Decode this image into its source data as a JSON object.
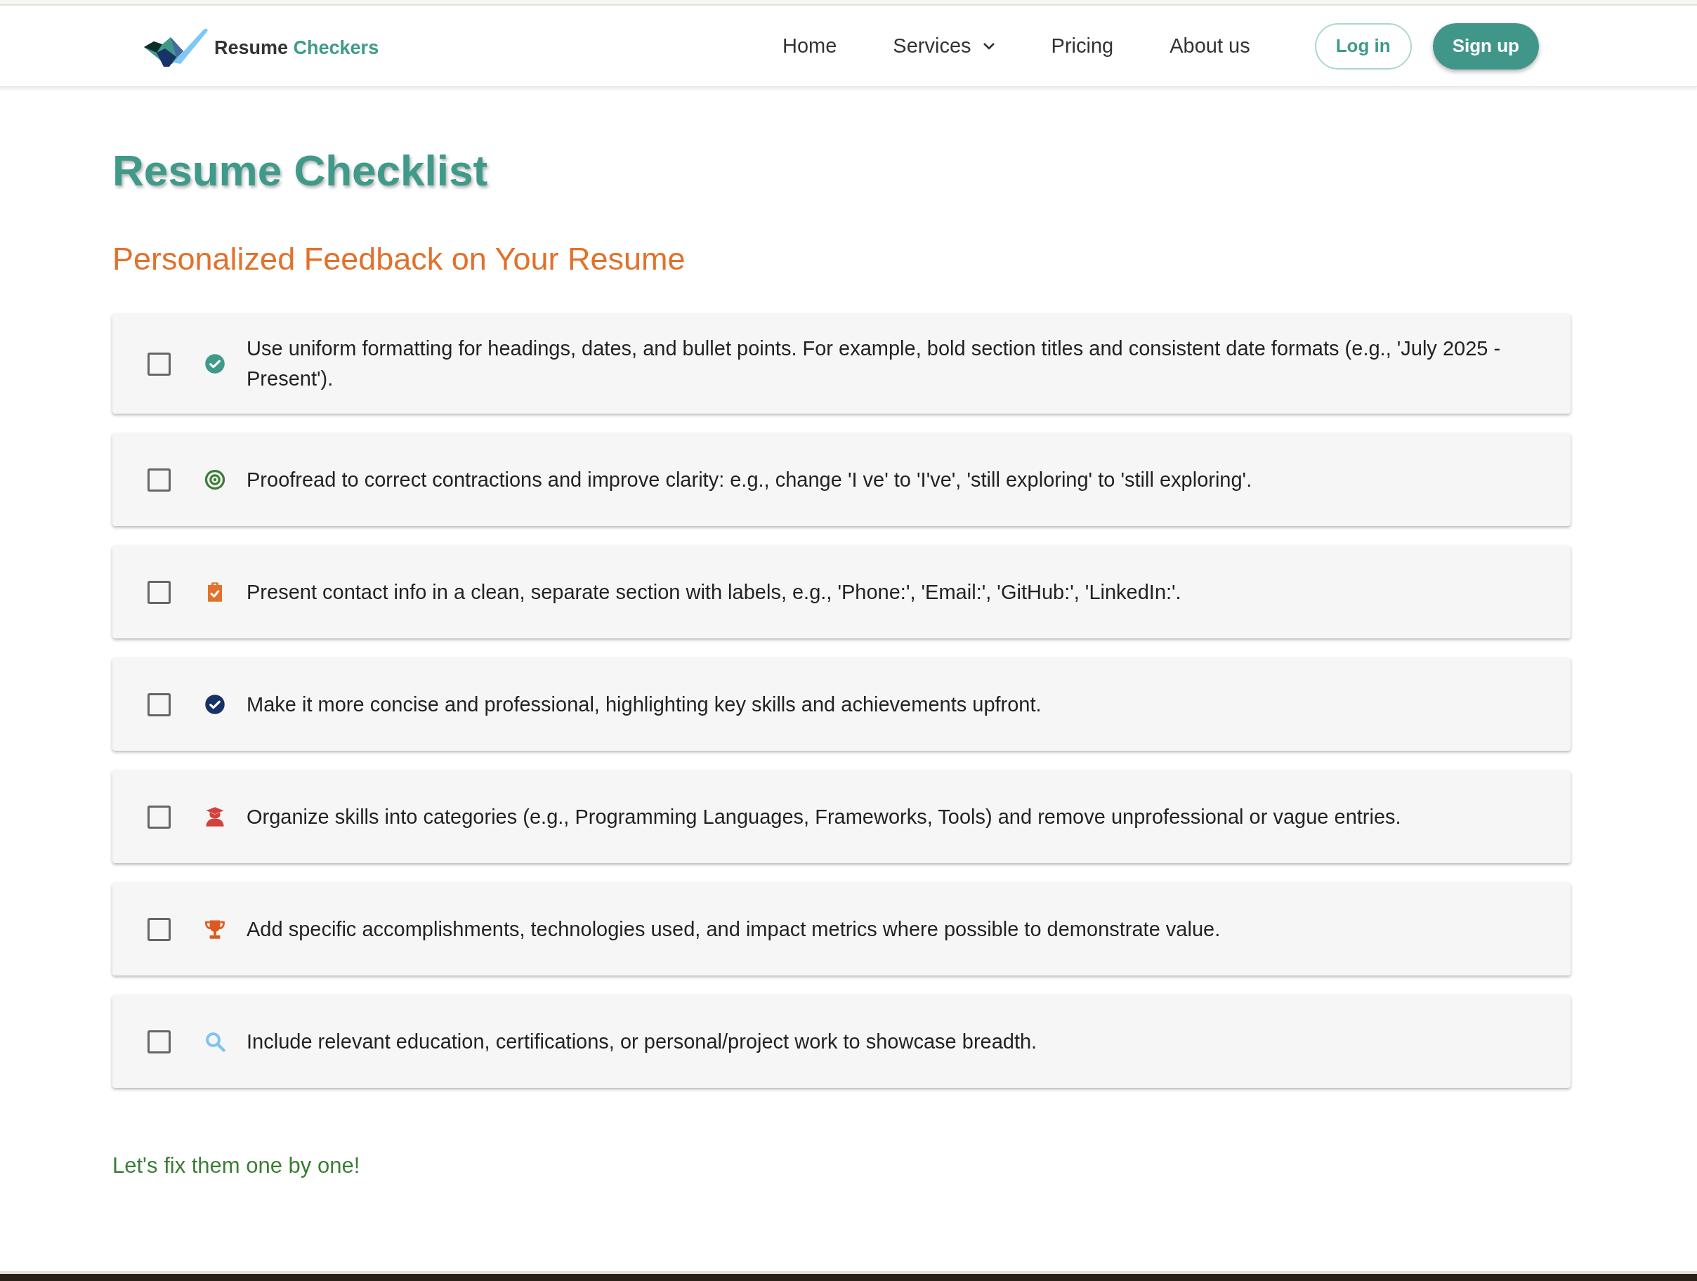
{
  "header": {
    "logo": {
      "word_1": "Resume",
      "word_2": "Checkers"
    },
    "nav": [
      {
        "label": "Home",
        "kind": "link"
      },
      {
        "label": "Services",
        "kind": "dropdown"
      },
      {
        "label": "Pricing",
        "kind": "link"
      },
      {
        "label": "About us",
        "kind": "link"
      }
    ],
    "buttons": [
      {
        "label": "Log in",
        "kind": "outline"
      },
      {
        "label": "Sign up",
        "kind": "filled"
      }
    ]
  },
  "title": "Resume Checklist",
  "subtitle": "Personalized Feedback on Your Resume",
  "items": [
    {
      "checked": false,
      "kind": "check-circle",
      "color": "#3f9a8a",
      "text": "Use uniform formatting for headings, dates, and bullet points. For example, bold section titles and consistent date formats (e.g., 'July 2025 - Present')."
    },
    {
      "checked": false,
      "kind": "target",
      "color": "#3b7d35",
      "text": "Proofread to correct contractions and improve clarity: e.g., change 'I ve' to 'I've', 'still exploring' to 'still exploring'."
    },
    {
      "checked": false,
      "kind": "clipboard",
      "color": "#e2712b",
      "text": "Present contact info in a clean, separate section with labels, e.g., 'Phone:', 'Email:', 'GitHub:', 'LinkedIn:'."
    },
    {
      "checked": false,
      "kind": "check-circle",
      "color": "#173166",
      "text": "Make it more concise and professional, highlighting key skills and achievements upfront."
    },
    {
      "checked": false,
      "kind": "graduate",
      "color": "#d2413a",
      "text": "Organize skills into categories (e.g., Programming Languages, Frameworks, Tools) and remove unprofessional or vague entries."
    },
    {
      "checked": false,
      "kind": "trophy",
      "color": "#dc5a1e",
      "text": "Add specific accomplishments, technologies used, and impact metrics where possible to demonstrate value."
    },
    {
      "checked": false,
      "kind": "search",
      "color": "#7cc4f2",
      "text": "Include relevant education, certifications, or personal/project work to showcase breadth."
    }
  ],
  "footer_note": "Let's fix them one by one!"
}
